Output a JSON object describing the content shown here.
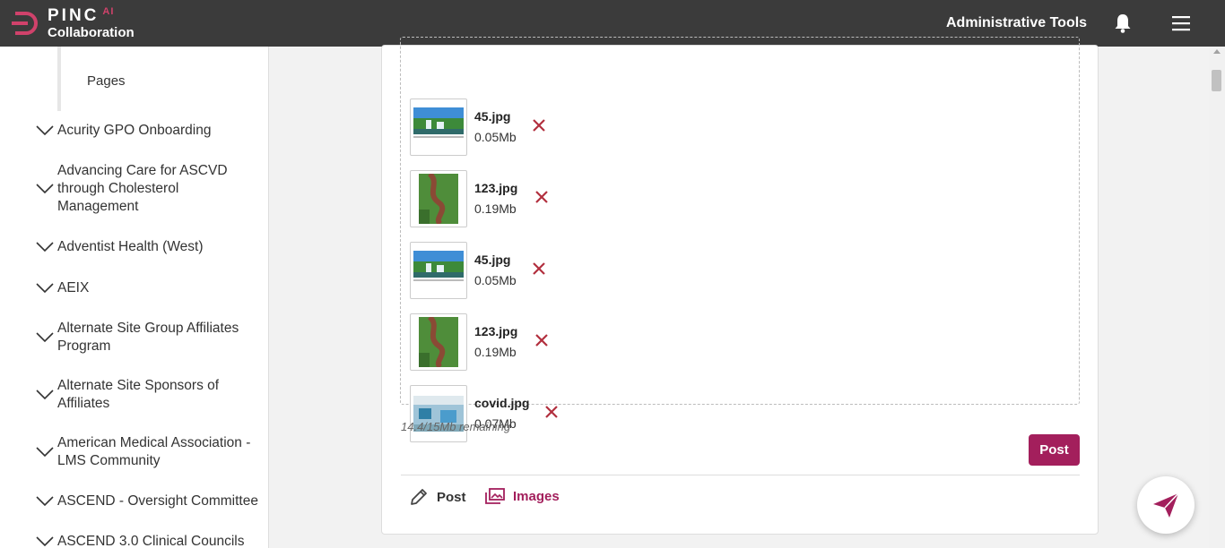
{
  "header": {
    "brand_name": "PINC",
    "brand_ai": "AI",
    "brand_sub": "Collaboration",
    "admin_tools": "Administrative Tools",
    "icons": [
      "bell-icon",
      "hamburger-menu-icon"
    ]
  },
  "sidebar": {
    "pages_label": "Pages",
    "items": [
      {
        "label": "Acurity GPO Onboarding"
      },
      {
        "label": "Advancing Care for ASCVD through Cholesterol Management"
      },
      {
        "label": "Adventist Health (West)"
      },
      {
        "label": "AEIX"
      },
      {
        "label": "Alternate Site Group Affiliates Program"
      },
      {
        "label": "Alternate Site Sponsors of Affiliates"
      },
      {
        "label": "American Medical Association - LMS Community"
      },
      {
        "label": "ASCEND - Oversight Committee"
      },
      {
        "label": "ASCEND 3.0 Clinical Councils"
      }
    ]
  },
  "attachments": [
    {
      "name": "45.jpg",
      "size": "0.05Mb",
      "thumb": "waterfall"
    },
    {
      "name": "123.jpg",
      "size": "0.19Mb",
      "thumb": "walkway"
    },
    {
      "name": "45.jpg",
      "size": "0.05Mb",
      "thumb": "waterfall"
    },
    {
      "name": "123.jpg",
      "size": "0.19Mb",
      "thumb": "walkway"
    },
    {
      "name": "covid.jpg",
      "size": "0.07Mb",
      "thumb": "hospital"
    }
  ],
  "composer": {
    "remaining": "14.4/15Mb remaining",
    "post_button": "Post",
    "tabs": [
      {
        "label": "Post",
        "icon": "pencil-icon",
        "active": false
      },
      {
        "label": "Images",
        "icon": "images-icon",
        "active": true
      }
    ]
  },
  "colors": {
    "brand": "#a31f5c",
    "remove": "#b22f3e",
    "header_bg": "#3b3b3b",
    "logo_accent": "#d0426b"
  }
}
